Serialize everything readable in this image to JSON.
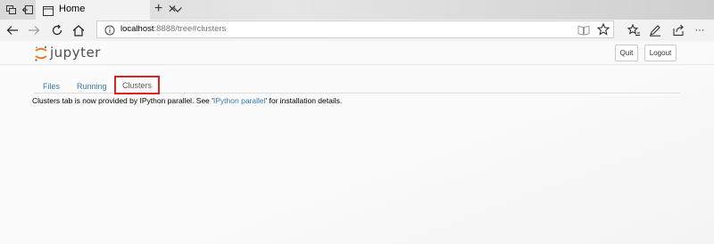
{
  "browser": {
    "tab_title": "Home",
    "new_tab_symbol": "+",
    "tab_close_symbol": "✕",
    "address": {
      "host": "localhost",
      "rest": ":8888/tree#clusters"
    },
    "window_controls": {
      "more": "···"
    }
  },
  "jupyter": {
    "logo_text": "jupyter",
    "quit_label": "Quit",
    "logout_label": "Logout",
    "tabs": [
      {
        "label": "Files"
      },
      {
        "label": "Running"
      },
      {
        "label": "Clusters"
      }
    ],
    "active_tab": "Clusters",
    "message": {
      "prefix": "Clusters tab is now provided by IPython parallel. See '",
      "link": "IPython parallel",
      "suffix": "' for installation details."
    }
  },
  "colors": {
    "link": "#337ab7",
    "highlight": "#e02020"
  },
  "icons": [
    "tab-manager-icon",
    "back-tabs-icon",
    "page-icon",
    "chevron-down-icon",
    "back-icon",
    "forward-icon",
    "refresh-icon",
    "home-icon",
    "info-icon",
    "reading-view-icon",
    "favorite-star-icon",
    "favorites-icon",
    "pen-icon",
    "share-icon",
    "more-icon"
  ]
}
